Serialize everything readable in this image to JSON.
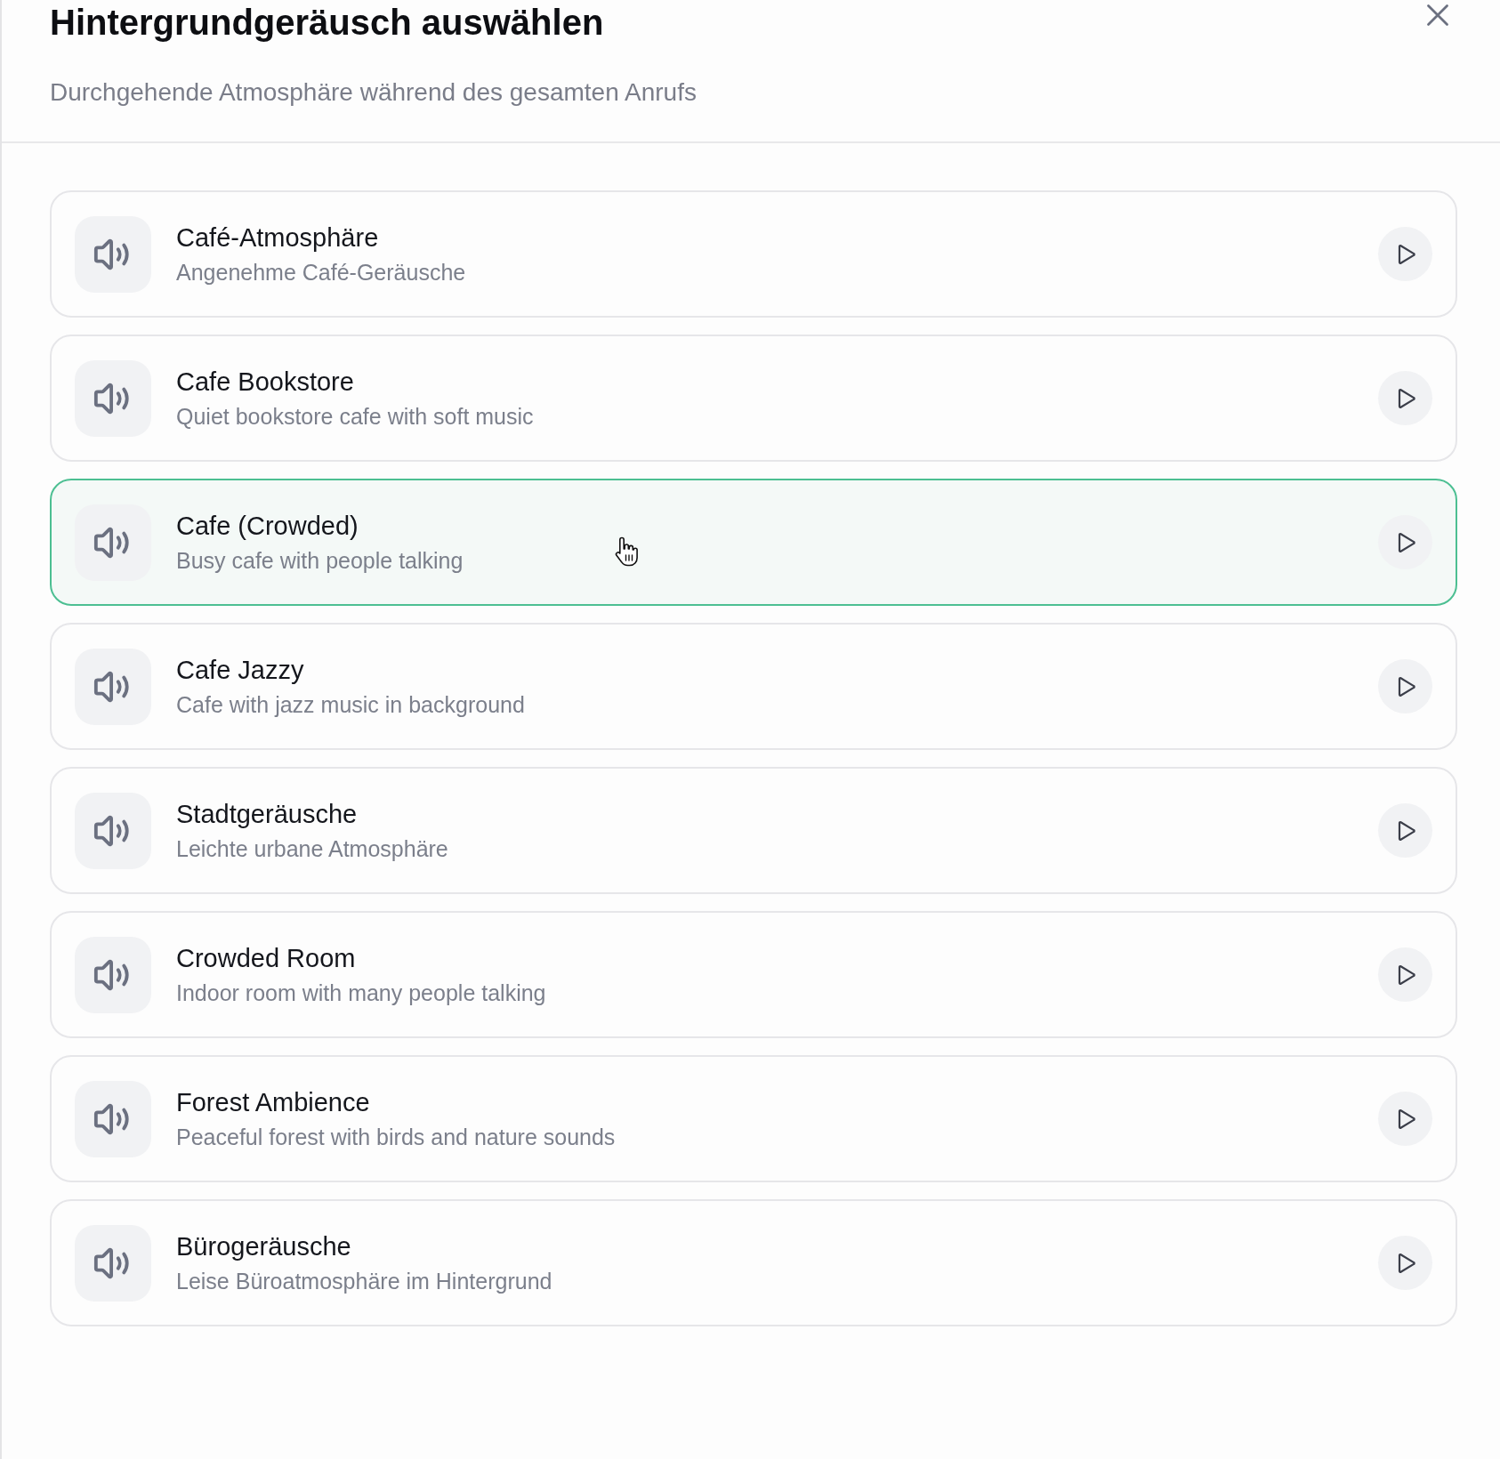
{
  "dialog": {
    "title": "Hintergrundgeräusch auswählen",
    "subtitle": "Durchgehende Atmosphäre während des gesamten Anrufs"
  },
  "sounds": [
    {
      "name": "Café-Atmosphäre",
      "description": "Angenehme Café-Geräusche",
      "selected": false
    },
    {
      "name": "Cafe Bookstore",
      "description": "Quiet bookstore cafe with soft music",
      "selected": false
    },
    {
      "name": "Cafe (Crowded)",
      "description": "Busy cafe with people talking",
      "selected": true
    },
    {
      "name": "Cafe Jazzy",
      "description": "Cafe with jazz music in background",
      "selected": false
    },
    {
      "name": "Stadtgeräusche",
      "description": "Leichte urbane Atmosphäre",
      "selected": false
    },
    {
      "name": "Crowded Room",
      "description": "Indoor room with many people talking",
      "selected": false
    },
    {
      "name": "Forest Ambience",
      "description": "Peaceful forest with birds and nature sounds",
      "selected": false
    },
    {
      "name": "Bürogeräusche",
      "description": "Leise Büroatmosphäre im Hintergrund",
      "selected": false
    }
  ]
}
